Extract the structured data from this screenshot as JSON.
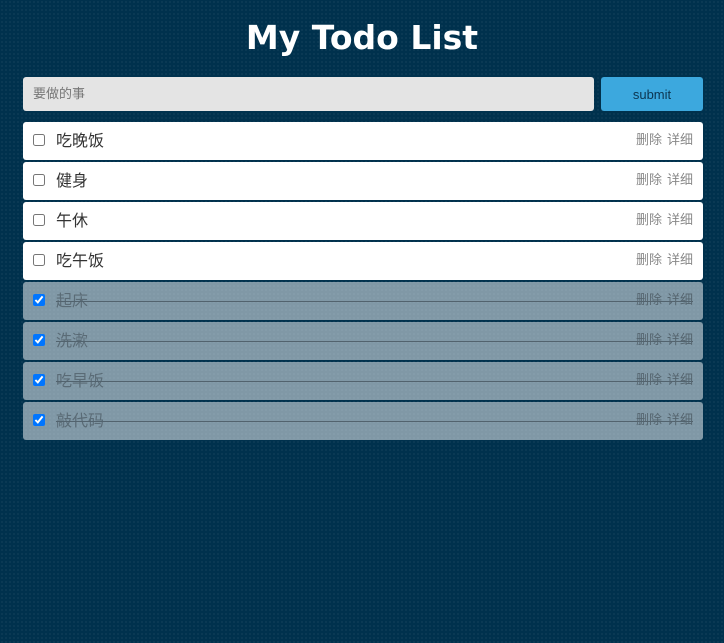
{
  "app": {
    "title": "My Todo List"
  },
  "form": {
    "input_placeholder": "要做的事",
    "input_value": "",
    "submit_label": "submit"
  },
  "actions": {
    "delete_label": "删除",
    "detail_label": "详细"
  },
  "todos": [
    {
      "text": "吃晚饭",
      "done": false
    },
    {
      "text": "健身",
      "done": false
    },
    {
      "text": "午休",
      "done": false
    },
    {
      "text": "吃午饭",
      "done": false
    },
    {
      "text": "起床",
      "done": true
    },
    {
      "text": "洗漱",
      "done": true
    },
    {
      "text": "吃早饭",
      "done": true
    },
    {
      "text": "敲代码",
      "done": true
    }
  ],
  "colors": {
    "background": "#00314d",
    "submit_button": "#3ca8de",
    "input_background": "#e4e4e4",
    "item_background": "#ffffff",
    "done_item_background": "#7e98a6"
  }
}
